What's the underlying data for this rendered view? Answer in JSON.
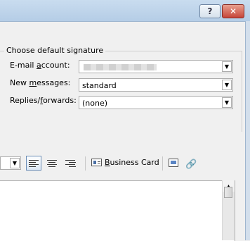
{
  "window": {
    "help_label": "?",
    "close_label": "✕"
  },
  "defaults": {
    "group_title": "Choose default signature",
    "email_account_label": "E-mail account:",
    "email_account_value": "",
    "new_messages_label": "New messages:",
    "new_messages_value": "standard",
    "replies_label": "Replies/forwards:",
    "replies_value": "(none)"
  },
  "toolbar": {
    "business_card_label": "Business Card",
    "icons": [
      "align-left-icon",
      "align-center-icon",
      "align-right-icon",
      "business-card-icon",
      "insert-picture-icon",
      "hyperlink-icon"
    ]
  }
}
